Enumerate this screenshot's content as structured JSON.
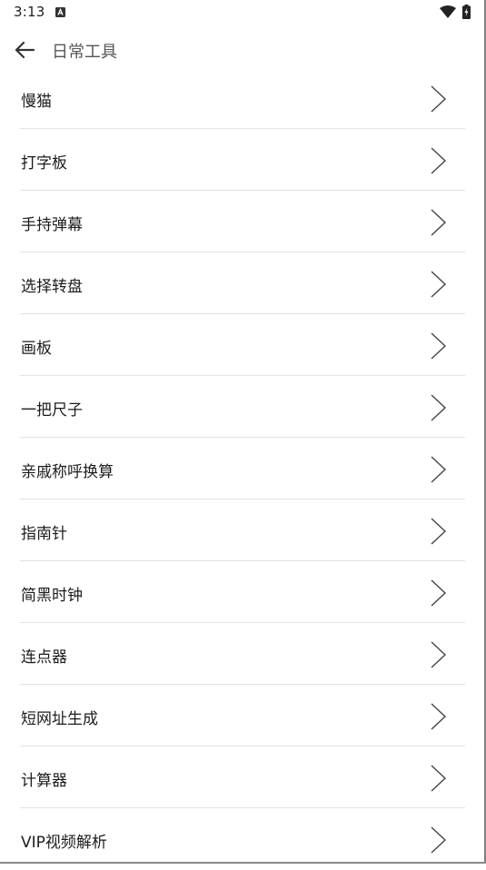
{
  "status_bar": {
    "time": "3:13"
  },
  "app_bar": {
    "title": "日常工具"
  },
  "tools": [
    {
      "label": "慢猫"
    },
    {
      "label": "打字板"
    },
    {
      "label": "手持弹幕"
    },
    {
      "label": "选择转盘"
    },
    {
      "label": "画板"
    },
    {
      "label": "一把尺子"
    },
    {
      "label": "亲戚称呼换算"
    },
    {
      "label": "指南针"
    },
    {
      "label": "简黑时钟"
    },
    {
      "label": "连点器"
    },
    {
      "label": "短网址生成"
    },
    {
      "label": "计算器"
    },
    {
      "label": "VIP视频解析"
    }
  ]
}
